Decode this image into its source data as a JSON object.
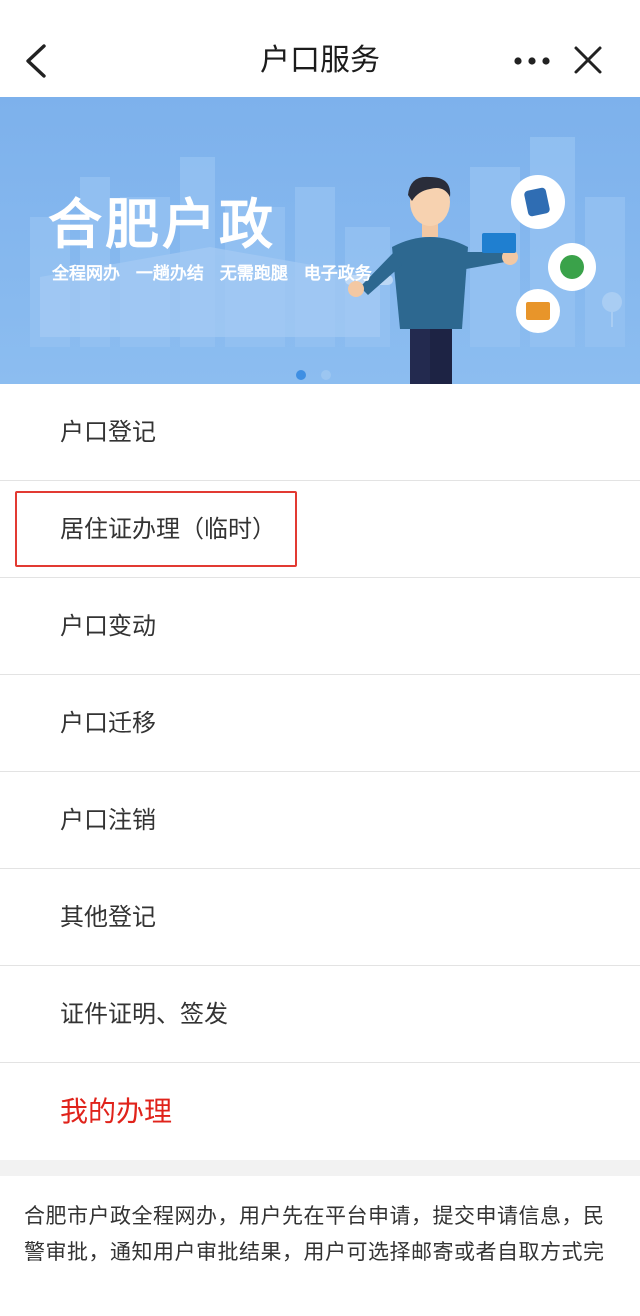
{
  "header": {
    "title": "户口服务",
    "back_icon": "chevron-left-icon",
    "more_icon": "more-dots-icon",
    "close_icon": "close-icon"
  },
  "banner": {
    "title": "合肥户政",
    "subtitle_items": [
      "全程网办",
      "一趟办结",
      "无需跑腿",
      "电子政务"
    ],
    "bg_color": "#7fb3ec"
  },
  "menu": {
    "items": [
      {
        "label": "户口登记",
        "highlighted": false
      },
      {
        "label": "居住证办理（临时）",
        "highlighted": true
      },
      {
        "label": "户口变动",
        "highlighted": false
      },
      {
        "label": "户口迁移",
        "highlighted": false
      },
      {
        "label": "户口注销",
        "highlighted": false
      },
      {
        "label": "其他登记",
        "highlighted": false
      },
      {
        "label": "证件证明、签发",
        "highlighted": false
      }
    ],
    "my_handle_label": "我的办理"
  },
  "description": "合肥市户政全程网办，用户先在平台申请，提交申请信息，民警审批，通知用户审批结果，用户可选择邮寄或者自取方式完",
  "colors": {
    "accent_red": "#e0231b",
    "highlight_border": "#e23a32",
    "divider": "#e3e3e3"
  }
}
